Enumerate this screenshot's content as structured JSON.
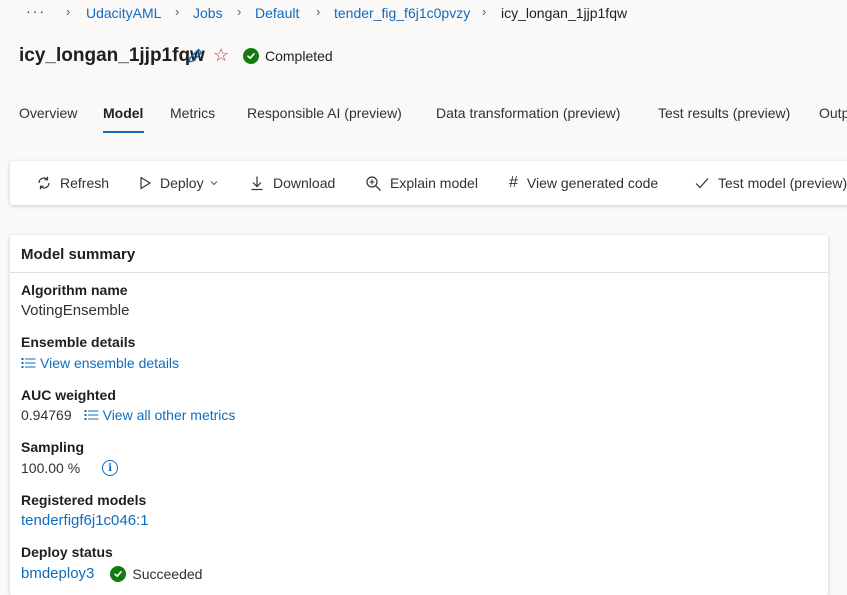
{
  "breadcrumb": {
    "more": "···",
    "items": [
      "UdacityAML",
      "Jobs",
      "Default",
      "tender_fig_f6j1c0pvzy",
      "icy_longan_1jjp1fqw"
    ]
  },
  "header": {
    "title": "icy_longan_1jjp1fqw",
    "status": "Completed"
  },
  "tabs": [
    {
      "label": "Overview"
    },
    {
      "label": "Model"
    },
    {
      "label": "Metrics"
    },
    {
      "label": "Responsible AI (preview)"
    },
    {
      "label": "Data transformation (preview)"
    },
    {
      "label": "Test results (preview)"
    },
    {
      "label": "Outp"
    }
  ],
  "toolbar": {
    "refresh": "Refresh",
    "deploy": "Deploy",
    "download": "Download",
    "explain": "Explain model",
    "view_code": "View generated code",
    "test_model": "Test model (preview)"
  },
  "summary": {
    "title": "Model summary",
    "algorithm_label": "Algorithm name",
    "algorithm_value": "VotingEnsemble",
    "ensemble_label": "Ensemble details",
    "ensemble_link": "View ensemble details",
    "auc_label": "AUC weighted",
    "auc_value": "0.94769",
    "metrics_link": "View all other metrics",
    "sampling_label": "Sampling",
    "sampling_value": "100.00 %",
    "registered_label": "Registered models",
    "registered_value": "tenderfigf6j1c046:1",
    "deploy_label": "Deploy status",
    "deploy_name": "bmdeploy3",
    "deploy_state": "Succeeded"
  },
  "colors": {
    "accent": "#0f6cbd",
    "success": "#107c10",
    "star": "#c4314b"
  }
}
